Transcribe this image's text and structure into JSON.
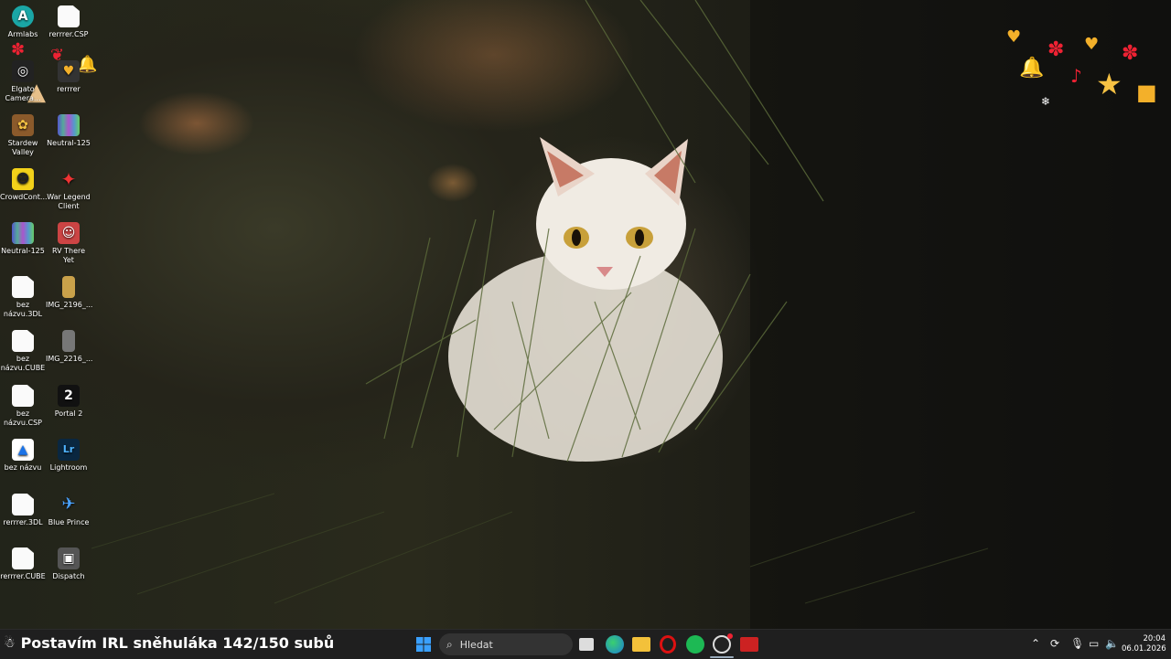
{
  "desktop": {
    "icons": [
      {
        "label": "Armlabs",
        "glyph": "A",
        "color": "#1aa6a6"
      },
      {
        "label": "rerrrer.CSP",
        "glyph": "",
        "color": ""
      },
      {
        "label": "Elgato Camera...",
        "glyph": "◎",
        "color": "#222"
      },
      {
        "label": "rerrrer",
        "glyph": "♥",
        "color": "#333"
      },
      {
        "label": "Stardew Valley",
        "glyph": "✿",
        "color": "#8b5a2b"
      },
      {
        "label": "Neutral-125",
        "glyph": "",
        "color": ""
      },
      {
        "label": "CrowdCont...",
        "glyph": "☻",
        "color": "#f2d11a"
      },
      {
        "label": "War Legend Client",
        "glyph": "✦",
        "color": "#d33"
      },
      {
        "label": "Neutral-125",
        "glyph": "",
        "color": ""
      },
      {
        "label": "RV There Yet",
        "glyph": "☺",
        "color": "#c44"
      },
      {
        "label": "bez názvu.3DL",
        "glyph": "",
        "color": ""
      },
      {
        "label": "IMG_2196_...",
        "glyph": "▮",
        "color": "#c9a14a"
      },
      {
        "label": "bez názvu.CUBE",
        "glyph": "",
        "color": ""
      },
      {
        "label": "IMG_2216_...",
        "glyph": "▮",
        "color": "#777"
      },
      {
        "label": "bez názvu.CSP",
        "glyph": "",
        "color": ""
      },
      {
        "label": "Portal 2",
        "glyph": "2",
        "color": "#111"
      },
      {
        "label": "bez názvu",
        "glyph": "▲",
        "color": "#fff"
      },
      {
        "label": "Lightroom",
        "glyph": "Lr",
        "color": "#0a2740"
      },
      {
        "label": "rerrrer.3DL",
        "glyph": "",
        "color": ""
      },
      {
        "label": "Blue Prince",
        "glyph": "✈",
        "color": "#1b5aa8"
      },
      {
        "label": "rerrrer.CUBE",
        "glyph": "",
        "color": ""
      },
      {
        "label": "Dispatch",
        "glyph": "▣",
        "color": "#555"
      }
    ]
  },
  "wallpaper": {
    "subject": "white-cat-in-grass"
  },
  "taskbar": {
    "overlay_text": "Postavím IRL sněhuláka 142/150 subů",
    "search_placeholder": "Hledat",
    "apps": [
      "start-icon",
      "task-view-icon",
      "edge-icon",
      "file-explorer-icon",
      "opera-icon",
      "spotify-icon",
      "obs-icon",
      "recorder-icon"
    ],
    "clock_time": "20:04",
    "clock_date": "06.01.2026"
  },
  "colors": {
    "taskbar_bg": "#1f1f1f",
    "accent": "#2f9be3"
  }
}
